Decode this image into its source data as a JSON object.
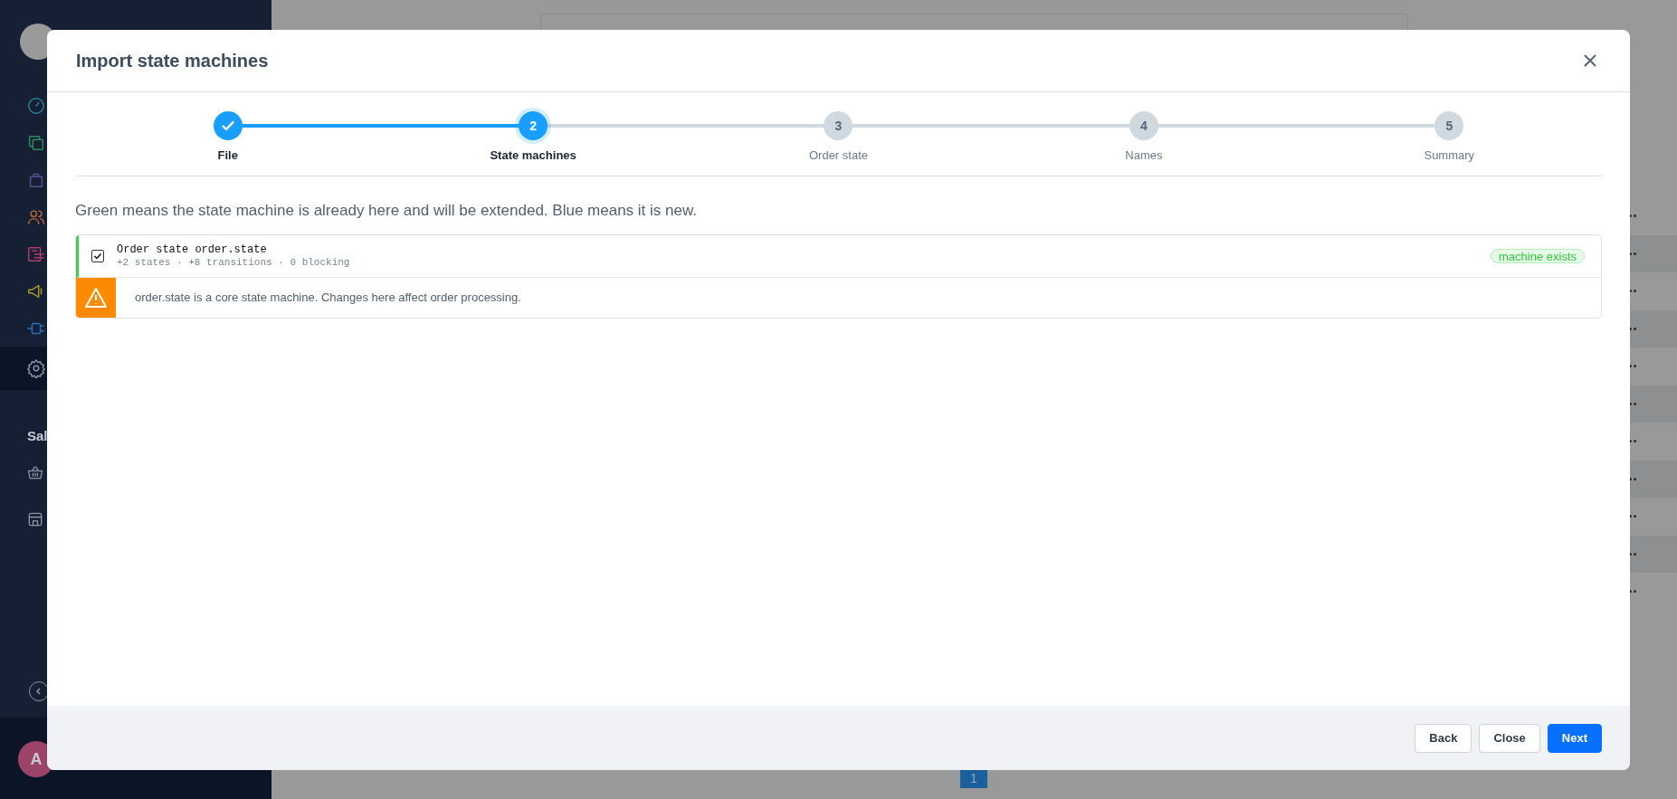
{
  "sidebar": {
    "items": [
      {
        "kind": "gauge",
        "selected": false
      },
      {
        "kind": "copy",
        "selected": false
      },
      {
        "kind": "bag",
        "selected": false
      },
      {
        "kind": "users",
        "selected": false
      },
      {
        "kind": "list",
        "selected": false
      },
      {
        "kind": "megaphone",
        "selected": false
      },
      {
        "kind": "plug",
        "selected": false
      },
      {
        "kind": "gear",
        "selected": true
      }
    ],
    "section_label": "Sal",
    "section_items": [
      {
        "kind": "basket"
      },
      {
        "kind": "store"
      }
    ],
    "avatar": "A"
  },
  "pagination": {
    "page": "1"
  },
  "dialog": {
    "title": "Import state machines",
    "steps": [
      {
        "label": "File",
        "done": true,
        "selected": false
      },
      {
        "number": "2",
        "label": "State machines",
        "done": false,
        "selected": true
      },
      {
        "number": "3",
        "label": "Order state",
        "done": false,
        "selected": false
      },
      {
        "number": "4",
        "label": "Names",
        "done": false,
        "selected": false
      },
      {
        "number": "5",
        "label": "Summary",
        "done": false,
        "selected": false
      }
    ],
    "intro": "Green means the state machine is already here and will be extended. Blue means it is new.",
    "machines": [
      {
        "title": "Order state order.state",
        "stats": "+2 states · +8 transitions · 0 blocking",
        "checked": true,
        "exists": true,
        "badge": "machine exists",
        "warning": "order.state is a core state machine. Changes here affect order processing."
      }
    ],
    "buttons": [
      {
        "label": "Back",
        "kind": "secondary"
      },
      {
        "label": "Close",
        "kind": "secondary"
      },
      {
        "label": "Next",
        "kind": "primary"
      }
    ]
  }
}
